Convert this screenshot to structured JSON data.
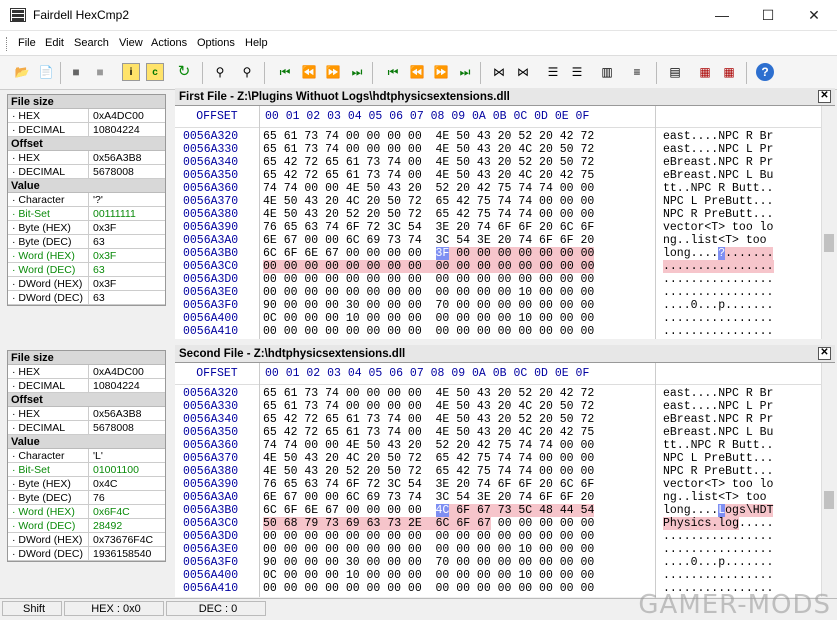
{
  "window": {
    "title": "Fairdell HexCmp2",
    "minimize": "—",
    "maximize": "☐",
    "close": "✕"
  },
  "menu": [
    "File",
    "Edit",
    "Search",
    "View",
    "Actions",
    "Options",
    "Help"
  ],
  "toolbar_icons": [
    "open-folder-icon",
    "open-file-icon",
    "stop-icon",
    "stop-gray-icon",
    "info-icon",
    "compare-icon",
    "refresh-icon",
    "binoculars-icon",
    "binoculars-next-icon",
    "first-diff-icon",
    "prev-diff-icon",
    "next-diff-icon",
    "last-diff-icon",
    "first-icon",
    "prev-icon",
    "next-icon",
    "last-icon",
    "sync-icon",
    "unsync-icon",
    "align-icon",
    "align2-icon",
    "columns-icon",
    "list-icon",
    "doc-icon",
    "report-icon",
    "report2-icon",
    "help-icon"
  ],
  "colors": {
    "offset": "#0000a0",
    "diff_highlight": "#f6c5cb",
    "cursor": "#7e8ff2",
    "green": "#0a8a0a"
  },
  "hex_columns": "00 01 02 03 04 05 06 07  08 09 0A 0B 0C 0D 0E 0F",
  "offset_header": "OFFSET",
  "first_info": {
    "rows": [
      {
        "h": true,
        "l": "File size"
      },
      {
        "l": " · HEX",
        "v": "0xA4DC00"
      },
      {
        "l": " · DECIMAL",
        "v": "10804224"
      },
      {
        "h": true,
        "l": "Offset"
      },
      {
        "l": " · HEX",
        "v": "0x56A3B8"
      },
      {
        "l": " · DECIMAL",
        "v": "5678008"
      },
      {
        "h": true,
        "l": "Value"
      },
      {
        "l": " · Character",
        "v": "'?'"
      },
      {
        "l": " · Bit-Set",
        "v": "00111111",
        "g": true
      },
      {
        "l": " · Byte (HEX)",
        "v": "0x3F"
      },
      {
        "l": " · Byte (DEC)",
        "v": "63"
      },
      {
        "l": " · Word (HEX)",
        "v": "0x3F",
        "g": true
      },
      {
        "l": " · Word (DEC)",
        "v": "63",
        "g": true
      },
      {
        "l": " · DWord (HEX)",
        "v": "0x3F"
      },
      {
        "l": " · DWord (DEC)",
        "v": "63"
      }
    ]
  },
  "second_info": {
    "rows": [
      {
        "h": true,
        "l": "File size"
      },
      {
        "l": " · HEX",
        "v": "0xA4DC00"
      },
      {
        "l": " · DECIMAL",
        "v": "10804224"
      },
      {
        "h": true,
        "l": "Offset"
      },
      {
        "l": " · HEX",
        "v": "0x56A3B8"
      },
      {
        "l": " · DECIMAL",
        "v": "5678008"
      },
      {
        "h": true,
        "l": "Value"
      },
      {
        "l": " · Character",
        "v": "'L'"
      },
      {
        "l": " · Bit-Set",
        "v": "01001100",
        "g": true
      },
      {
        "l": " · Byte (HEX)",
        "v": "0x4C"
      },
      {
        "l": " · Byte (DEC)",
        "v": "76"
      },
      {
        "l": " · Word (HEX)",
        "v": "0x6F4C",
        "g": true
      },
      {
        "l": " · Word (DEC)",
        "v": "28492",
        "g": true
      },
      {
        "l": " · DWord (HEX)",
        "v": "0x73676F4C"
      },
      {
        "l": " · DWord (DEC)",
        "v": "1936158540"
      }
    ]
  },
  "first_pane": {
    "title": "First File - Z:\\Plugins Withuot Logs\\hdtphysicsextensions.dll",
    "rows": [
      {
        "o": "0056A320",
        "b": "65 61 73 74 00 00 00 00  4E 50 43 20 52 20 42 72",
        "a": "east....NPC R Br"
      },
      {
        "o": "0056A330",
        "b": "65 61 73 74 00 00 00 00  4E 50 43 20 4C 20 50 72",
        "a": "east....NPC L Pr"
      },
      {
        "o": "0056A340",
        "b": "65 42 72 65 61 73 74 00  4E 50 43 20 52 20 50 72",
        "a": "eBreast.NPC R Pr"
      },
      {
        "o": "0056A350",
        "b": "65 42 72 65 61 73 74 00  4E 50 43 20 4C 20 42 75",
        "a": "eBreast.NPC L Bu"
      },
      {
        "o": "0056A360",
        "b": "74 74 00 00 4E 50 43 20  52 20 42 75 74 74 00 00",
        "a": "tt..NPC R Butt.."
      },
      {
        "o": "0056A370",
        "b": "4E 50 43 20 4C 20 50 72  65 42 75 74 74 00 00 00",
        "a": "NPC L PreButt..."
      },
      {
        "o": "0056A380",
        "b": "4E 50 43 20 52 20 50 72  65 42 75 74 74 00 00 00",
        "a": "NPC R PreButt..."
      },
      {
        "o": "0056A390",
        "b": "76 65 63 74 6F 72 3C 54  3E 20 74 6F 6F 20 6C 6F",
        "a": "vector<T> too lo"
      },
      {
        "o": "0056A3A0",
        "b": "6E 67 00 00 6C 69 73 74  3C 54 3E 20 74 6F 6F 20",
        "a": "ng..list<T> too "
      },
      {
        "o": "0056A3B0",
        "b": "6C 6F 6E 67 00 00 00 00  3F 00 00 00 00 00 00 00",
        "a": "long....?.......",
        "hl": "first"
      },
      {
        "o": "0056A3C0",
        "b": "00 00 00 00 00 00 00 00  00 00 00 00 00 00 00 00",
        "a": "................",
        "hl": "full"
      },
      {
        "o": "0056A3D0",
        "b": "00 00 00 00 00 00 00 00  00 00 00 00 00 00 00 00",
        "a": "................"
      },
      {
        "o": "0056A3E0",
        "b": "00 00 00 00 00 00 00 00  00 00 00 00 10 00 00 00",
        "a": "................"
      },
      {
        "o": "0056A3F0",
        "b": "90 00 00 00 30 00 00 00  70 00 00 00 00 00 00 00",
        "a": "....0...p......."
      },
      {
        "o": "0056A400",
        "b": "0C 00 00 00 10 00 00 00  00 00 00 00 10 00 00 00",
        "a": "................"
      },
      {
        "o": "0056A410",
        "b": "00 00 00 00 00 00 00 00  00 00 00 00 00 00 00 00",
        "a": "................"
      }
    ]
  },
  "second_pane": {
    "title": "Second File - Z:\\hdtphysicsextensions.dll",
    "rows": [
      {
        "o": "0056A320",
        "b": "65 61 73 74 00 00 00 00  4E 50 43 20 52 20 42 72",
        "a": "east....NPC R Br"
      },
      {
        "o": "0056A330",
        "b": "65 61 73 74 00 00 00 00  4E 50 43 20 4C 20 50 72",
        "a": "east....NPC L Pr"
      },
      {
        "o": "0056A340",
        "b": "65 42 72 65 61 73 74 00  4E 50 43 20 52 20 50 72",
        "a": "eBreast.NPC R Pr"
      },
      {
        "o": "0056A350",
        "b": "65 42 72 65 61 73 74 00  4E 50 43 20 4C 20 42 75",
        "a": "eBreast.NPC L Bu"
      },
      {
        "o": "0056A360",
        "b": "74 74 00 00 4E 50 43 20  52 20 42 75 74 74 00 00",
        "a": "tt..NPC R Butt.."
      },
      {
        "o": "0056A370",
        "b": "4E 50 43 20 4C 20 50 72  65 42 75 74 74 00 00 00",
        "a": "NPC L PreButt..."
      },
      {
        "o": "0056A380",
        "b": "4E 50 43 20 52 20 50 72  65 42 75 74 74 00 00 00",
        "a": "NPC R PreButt..."
      },
      {
        "o": "0056A390",
        "b": "76 65 63 74 6F 72 3C 54  3E 20 74 6F 6F 20 6C 6F",
        "a": "vector<T> too lo"
      },
      {
        "o": "0056A3A0",
        "b": "6E 67 00 00 6C 69 73 74  3C 54 3E 20 74 6F 6F 20",
        "a": "ng..list<T> too "
      },
      {
        "o": "0056A3B0",
        "b": "6C 6F 6E 67 00 00 00 00  4C 6F 67 73 5C 48 44 54",
        "a": "long....Logs\\HDT",
        "hl": "second_a"
      },
      {
        "o": "0056A3C0",
        "b": "50 68 79 73 69 63 73 2E  6C 6F 67 00 00 00 00 00",
        "a": "Physics.log.....",
        "hl": "second_b"
      },
      {
        "o": "0056A3D0",
        "b": "00 00 00 00 00 00 00 00  00 00 00 00 00 00 00 00",
        "a": "................"
      },
      {
        "o": "0056A3E0",
        "b": "00 00 00 00 00 00 00 00  00 00 00 00 10 00 00 00",
        "a": "................"
      },
      {
        "o": "0056A3F0",
        "b": "90 00 00 00 30 00 00 00  70 00 00 00 00 00 00 00",
        "a": "....0...p......."
      },
      {
        "o": "0056A400",
        "b": "0C 00 00 00 10 00 00 00  00 00 00 00 10 00 00 00",
        "a": "................"
      },
      {
        "o": "0056A410",
        "b": "00 00 00 00 00 00 00 00  00 00 00 00 00 00 00 00",
        "a": "................"
      }
    ]
  },
  "status": {
    "shift": "Shift",
    "hex": "HEX : 0x0",
    "dec": "DEC : 0"
  },
  "watermark": "GAMER-MODS"
}
